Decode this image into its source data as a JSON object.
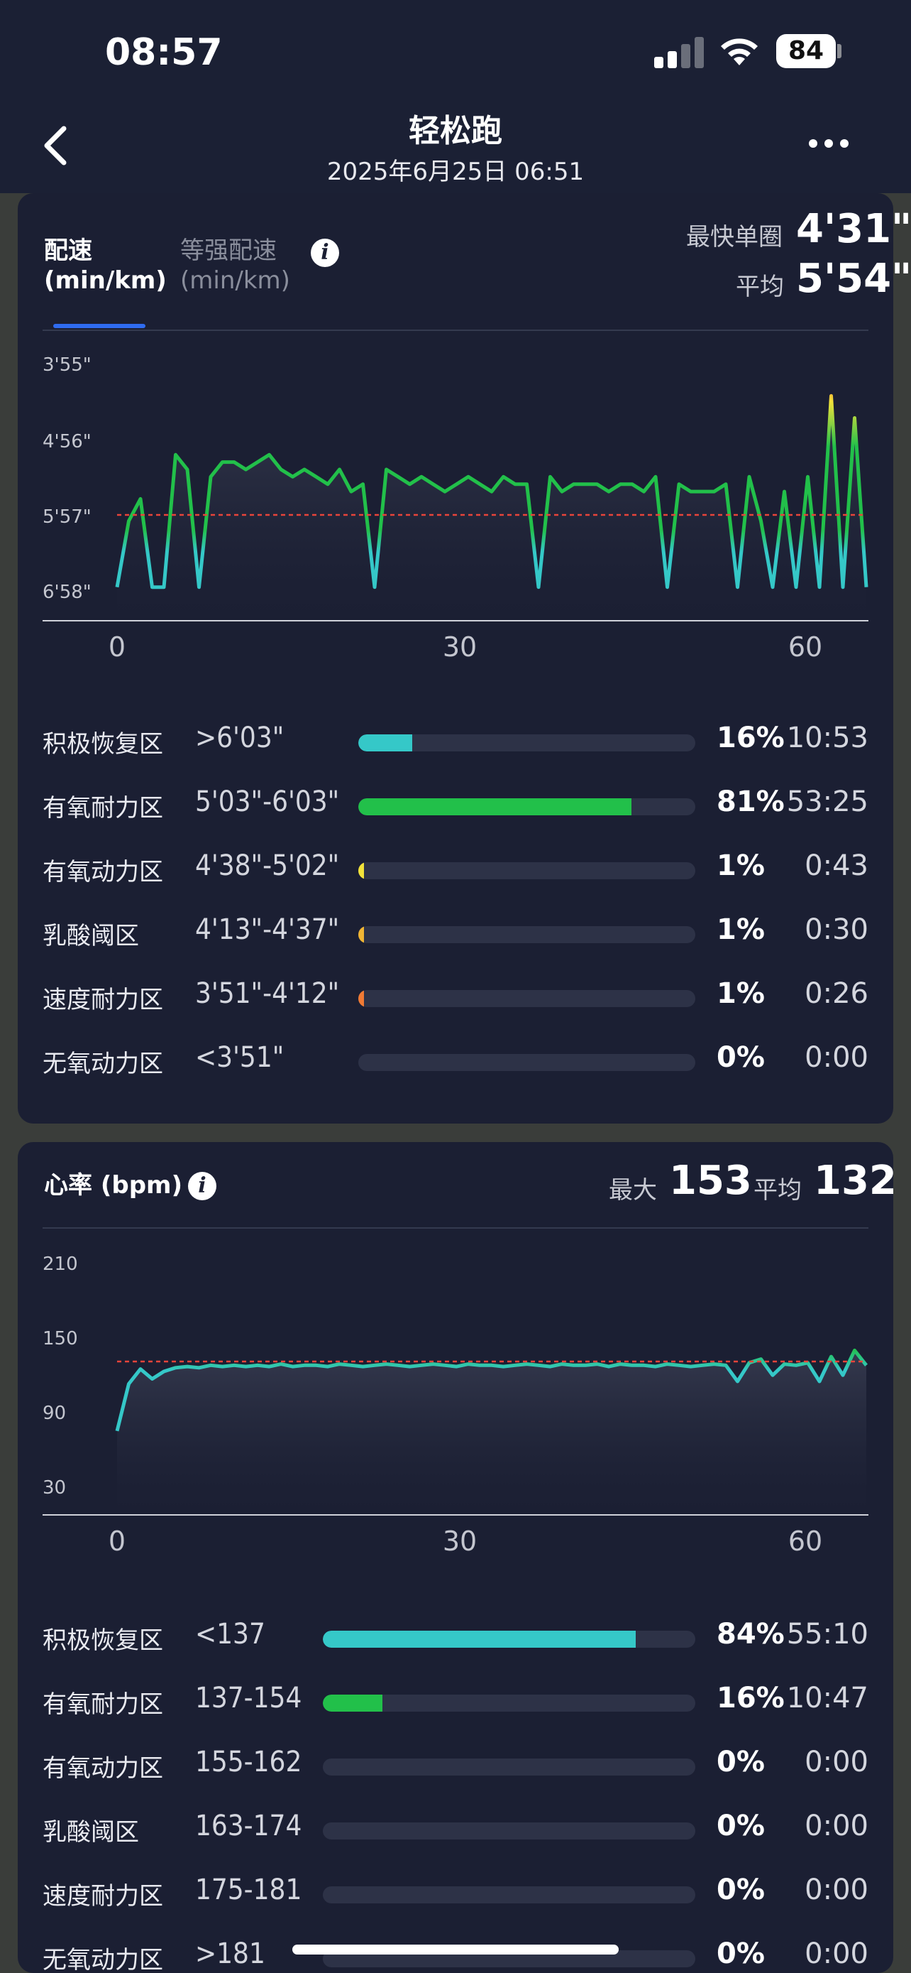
{
  "status": {
    "time": "08:57",
    "battery": "84"
  },
  "header": {
    "title": "轻松跑",
    "subtitle": "2025年6月25日 06:51"
  },
  "pace": {
    "tab_active": "配速\n(min/km)",
    "tab_active_line1": "配速",
    "tab_active_line2": "(min/km)",
    "tab_inactive_line1": "等强配速",
    "tab_inactive_line2": "(min/km)",
    "fastest_label": "最快单圈",
    "fastest_value": "4'31\"",
    "avg_label": "平均",
    "avg_value": "5'54\"",
    "y_ticks": [
      "3'55\"",
      "4'56\"",
      "5'57\"",
      "6'58\""
    ],
    "x_ticks": [
      "0",
      "30",
      "60"
    ],
    "zones": [
      {
        "name": "积极恢复区",
        "range": ">6'03\"",
        "percent": "16%",
        "time": "10:53",
        "fraction": 0.16,
        "color": "#35c8c8"
      },
      {
        "name": "有氧耐力区",
        "range": "5'03\"-6'03\"",
        "percent": "81%",
        "time": "53:25",
        "fraction": 0.81,
        "color": "#22c04a"
      },
      {
        "name": "有氧动力区",
        "range": "4'38\"-5'02\"",
        "percent": "1%",
        "time": "0:43",
        "fraction": 0.01,
        "color": "#f2e23a"
      },
      {
        "name": "乳酸阈区",
        "range": "4'13\"-4'37\"",
        "percent": "1%",
        "time": "0:30",
        "fraction": 0.01,
        "color": "#f0b534"
      },
      {
        "name": "速度耐力区",
        "range": "3'51\"-4'12\"",
        "percent": "1%",
        "time": "0:26",
        "fraction": 0.01,
        "color": "#f07a34"
      },
      {
        "name": "无氧动力区",
        "range": "<3'51\"",
        "percent": "0%",
        "time": "0:00",
        "fraction": 0,
        "color": "#e8442e"
      }
    ]
  },
  "heart": {
    "title": "心率 (bpm)",
    "max_label": "最大",
    "max_value": "153",
    "avg_label": "平均",
    "avg_value": "132",
    "y_ticks": [
      "210",
      "150",
      "90",
      "30"
    ],
    "x_ticks": [
      "0",
      "30",
      "60"
    ],
    "zones": [
      {
        "name": "积极恢复区",
        "range": "<137",
        "percent": "84%",
        "time": "55:10",
        "fraction": 0.84,
        "color": "#35c8c8"
      },
      {
        "name": "有氧耐力区",
        "range": "137-154",
        "percent": "16%",
        "time": "10:47",
        "fraction": 0.16,
        "color": "#22c04a"
      },
      {
        "name": "有氧动力区",
        "range": "155-162",
        "percent": "0%",
        "time": "0:00",
        "fraction": 0,
        "color": "#f2e23a"
      },
      {
        "name": "乳酸阈区",
        "range": "163-174",
        "percent": "0%",
        "time": "0:00",
        "fraction": 0,
        "color": "#f0b534"
      },
      {
        "name": "速度耐力区",
        "range": "175-181",
        "percent": "0%",
        "time": "0:00",
        "fraction": 0,
        "color": "#f07a34"
      },
      {
        "name": "无氧动力区",
        "range": ">181",
        "percent": "0%",
        "time": "0:00",
        "fraction": 0,
        "color": "#e8442e"
      }
    ]
  },
  "chart_data": [
    {
      "type": "line",
      "x_range": [
        0,
        65
      ],
      "y_ticks": [
        "3'55\"",
        "4'56\"",
        "5'57\"",
        "6'58\""
      ],
      "avg_line": "5'54\"",
      "series": [
        {
          "values": [
            6.9,
            6.0,
            5.7,
            6.9,
            6.9,
            5.1,
            5.3,
            6.9,
            5.4,
            5.2,
            5.2,
            5.3,
            5.2,
            5.1,
            5.3,
            5.4,
            5.3,
            5.4,
            5.5,
            5.3,
            5.6,
            5.5,
            6.9,
            5.3,
            5.4,
            5.5,
            5.4,
            5.5,
            5.6,
            5.5,
            5.4,
            5.5,
            5.6,
            5.4,
            5.5,
            5.5,
            6.9,
            5.4,
            5.6,
            5.5,
            5.5,
            5.5,
            5.6,
            5.5,
            5.5,
            5.6,
            5.4,
            6.9,
            5.5,
            5.6,
            5.6,
            5.6,
            5.5,
            6.9,
            5.4,
            6.0,
            6.9,
            5.6,
            6.9,
            5.4,
            6.9,
            4.3,
            6.9,
            4.6,
            6.9
          ]
        }
      ]
    },
    {
      "type": "line",
      "x_range": [
        0,
        65
      ],
      "y_ticks": [
        "210",
        "150",
        "90",
        "30"
      ],
      "avg_line": "132",
      "series": [
        {
          "values": [
            80,
            118,
            130,
            122,
            128,
            131,
            132,
            131,
            133,
            132,
            133,
            132,
            133,
            132,
            134,
            132,
            133,
            133,
            132,
            134,
            133,
            132,
            133,
            134,
            133,
            132,
            133,
            134,
            133,
            132,
            134,
            133,
            133,
            132,
            133,
            134,
            133,
            132,
            134,
            133,
            133,
            134,
            132,
            134,
            133,
            133,
            132,
            134,
            133,
            132,
            133,
            134,
            133,
            120,
            135,
            138,
            125,
            134,
            133,
            135,
            120,
            140,
            125,
            145,
            133
          ]
        }
      ]
    }
  ]
}
